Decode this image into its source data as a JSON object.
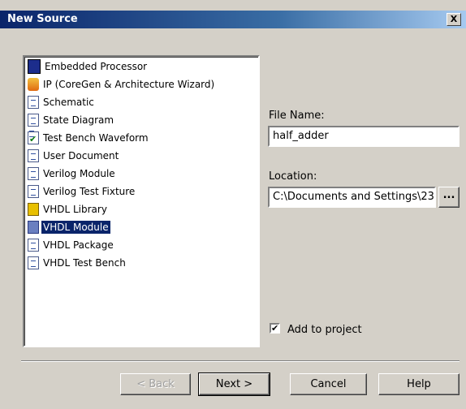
{
  "dialog": {
    "title": "New Source",
    "close_label": "X"
  },
  "source_types": [
    {
      "label": "Embedded Processor",
      "icon": "embedded-processor-icon",
      "selected": false
    },
    {
      "label": "IP (CoreGen & Architecture Wizard)",
      "icon": "ip-coregen-icon",
      "selected": false
    },
    {
      "label": "Schematic",
      "icon": "schematic-icon",
      "selected": false
    },
    {
      "label": "State Diagram",
      "icon": "state-diagram-icon",
      "selected": false
    },
    {
      "label": "Test Bench Waveform",
      "icon": "test-bench-waveform-icon",
      "selected": false
    },
    {
      "label": "User Document",
      "icon": "user-document-icon",
      "selected": false
    },
    {
      "label": "Verilog Module",
      "icon": "verilog-module-icon",
      "selected": false
    },
    {
      "label": "Verilog Test Fixture",
      "icon": "verilog-test-fixture-icon",
      "selected": false
    },
    {
      "label": "VHDL Library",
      "icon": "vhdl-library-icon",
      "selected": false
    },
    {
      "label": "VHDL Module",
      "icon": "vhdl-module-icon",
      "selected": true
    },
    {
      "label": "VHDL Package",
      "icon": "vhdl-package-icon",
      "selected": false
    },
    {
      "label": "VHDL Test Bench",
      "icon": "vhdl-test-bench-icon",
      "selected": false
    }
  ],
  "file_name": {
    "label": "File Name:",
    "value": "half_adder"
  },
  "location": {
    "label": "Location:",
    "value": "C:\\Documents and Settings\\23",
    "browse_label": "..."
  },
  "add_to_project": {
    "label": "Add to project",
    "checked": true,
    "mark": "✔"
  },
  "buttons": {
    "back": "< Back",
    "next": "Next >",
    "cancel": "Cancel",
    "help": "Help"
  },
  "colors": {
    "selection": "#0a246a",
    "dialog_bg": "#d4d0c8"
  }
}
